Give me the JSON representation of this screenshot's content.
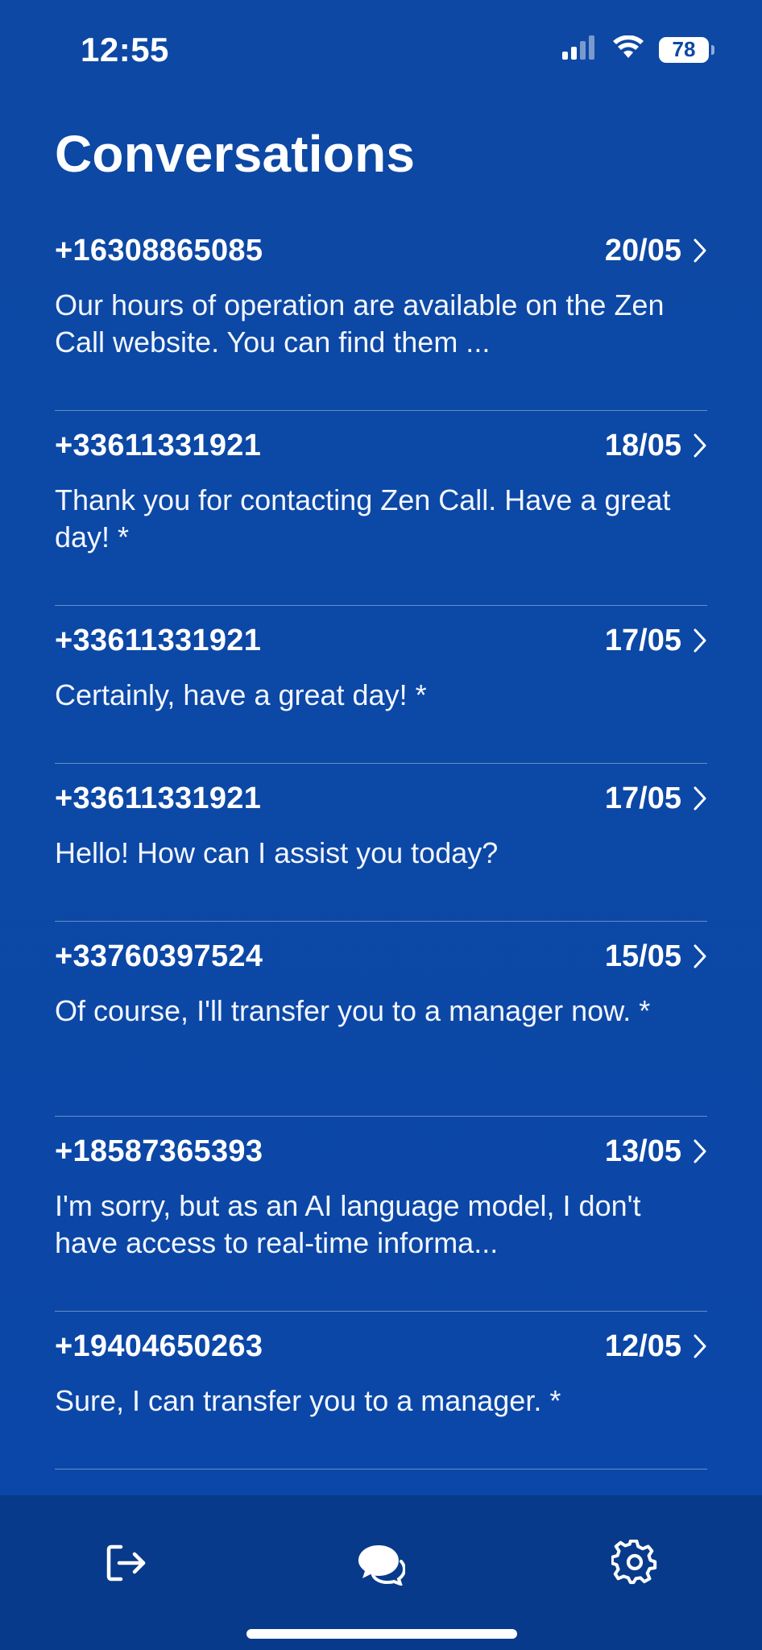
{
  "status_bar": {
    "time": "12:55",
    "battery": "78",
    "icons": [
      "cellular-signal-icon",
      "wifi-icon",
      "battery-icon"
    ]
  },
  "page": {
    "title": "Conversations"
  },
  "conversations": [
    {
      "number": "+16308865085",
      "date": "20/05",
      "preview": "Our hours of operation are available on the Zen Call website. You can find them ..."
    },
    {
      "number": "+33611331921",
      "date": "18/05",
      "preview": "Thank you for contacting Zen Call. Have a great day! *"
    },
    {
      "number": "+33611331921",
      "date": "17/05",
      "preview": "Certainly, have a great day! *"
    },
    {
      "number": "+33611331921",
      "date": "17/05",
      "preview": "Hello! How can I assist you today?"
    },
    {
      "number": "+33760397524",
      "date": "15/05",
      "preview": "Of course, I'll transfer you to a manager now. *"
    },
    {
      "number": "+18587365393",
      "date": "13/05",
      "preview": "I'm sorry, but as an AI language model, I don't have access to real-time informa..."
    },
    {
      "number": "+19404650263",
      "date": "12/05",
      "preview": "Sure, I can transfer you to a manager. *"
    }
  ],
  "tab_bar": {
    "items": [
      "logout-icon",
      "chat-bubbles-icon",
      "gear-icon"
    ]
  },
  "colors": {
    "background": "#0d48a4",
    "tab_bar": "#073a8a",
    "text": "#ffffff"
  }
}
